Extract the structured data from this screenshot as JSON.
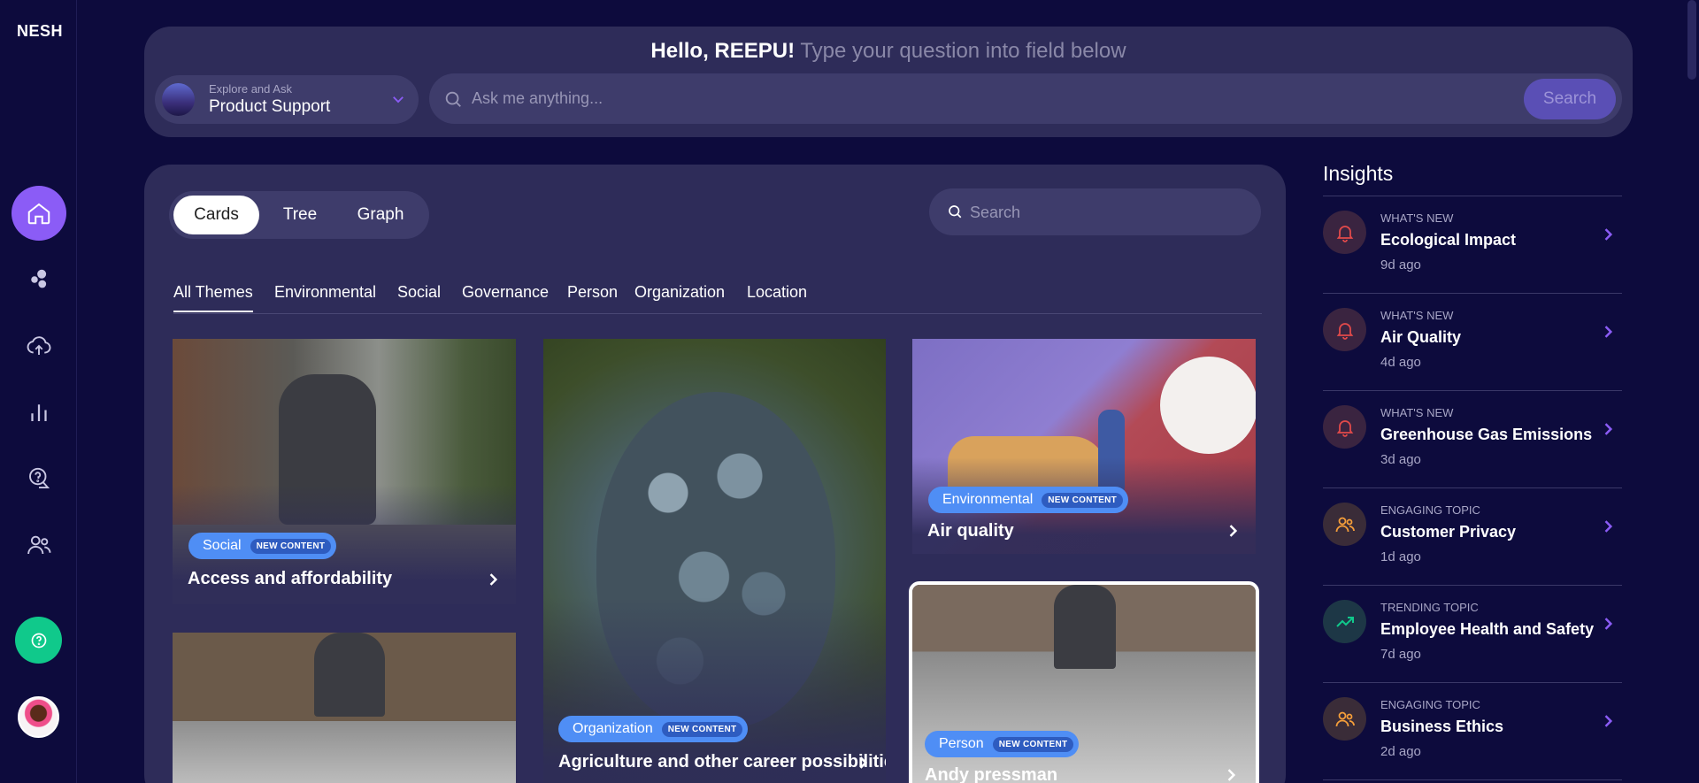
{
  "app": {
    "logo": "NESH"
  },
  "sidebar": {
    "items": [
      {
        "icon": "home-icon"
      },
      {
        "icon": "bubbles-icon"
      },
      {
        "icon": "upload-cloud-icon"
      },
      {
        "icon": "bar-chart-icon"
      },
      {
        "icon": "chat-question-icon"
      },
      {
        "icon": "users-icon"
      }
    ],
    "help_icon": "help-circle-icon"
  },
  "ask": {
    "greeting": "Hello, REEPU!",
    "subtitle": "Type your question into field below",
    "source_label": "Explore and Ask",
    "source_value": "Product Support",
    "placeholder": "Ask me anything...",
    "search_label": "Search"
  },
  "content": {
    "views": [
      "Cards",
      "Tree",
      "Graph"
    ],
    "active_view": "Cards",
    "search_placeholder": "Search",
    "themes": [
      "All Themes",
      "Environmental",
      "Social",
      "Governance",
      "Person",
      "Organization",
      "Location"
    ],
    "active_theme": "All Themes",
    "new_badge": "NEW CONTENT",
    "cards": [
      {
        "tag": "Social",
        "title": "Access and affordability"
      },
      {
        "tag": "Organization",
        "title": "Agriculture and other career possibilities"
      },
      {
        "tag": "Environmental",
        "title": "Air quality"
      },
      {
        "tag": "Person",
        "title": "Andy pressman"
      }
    ]
  },
  "insights": {
    "title": "Insights",
    "items": [
      {
        "kind": "WHAT'S NEW",
        "name": "Ecological Impact",
        "age": "9d ago",
        "icon": "bell-icon",
        "color": "#e24a4a"
      },
      {
        "kind": "WHAT'S NEW",
        "name": "Air Quality",
        "age": "4d ago",
        "icon": "bell-icon",
        "color": "#e24a4a"
      },
      {
        "kind": "WHAT'S NEW",
        "name": "Greenhouse Gas Emissions",
        "age": "3d ago",
        "icon": "bell-icon",
        "color": "#e24a4a"
      },
      {
        "kind": "ENGAGING TOPIC",
        "name": "Customer Privacy",
        "age": "1d ago",
        "icon": "users-icon",
        "color": "#f59e3a"
      },
      {
        "kind": "TRENDING TOPIC",
        "name": "Employee Health and Safety",
        "age": "7d ago",
        "icon": "trending-up-icon",
        "color": "#10c98b"
      },
      {
        "kind": "ENGAGING TOPIC",
        "name": "Business Ethics",
        "age": "2d ago",
        "icon": "users-icon",
        "color": "#f59e3a"
      }
    ]
  },
  "colors": {
    "accent": "#8b5cf6",
    "badge": "#4f8ef5",
    "help": "#10c98b"
  }
}
